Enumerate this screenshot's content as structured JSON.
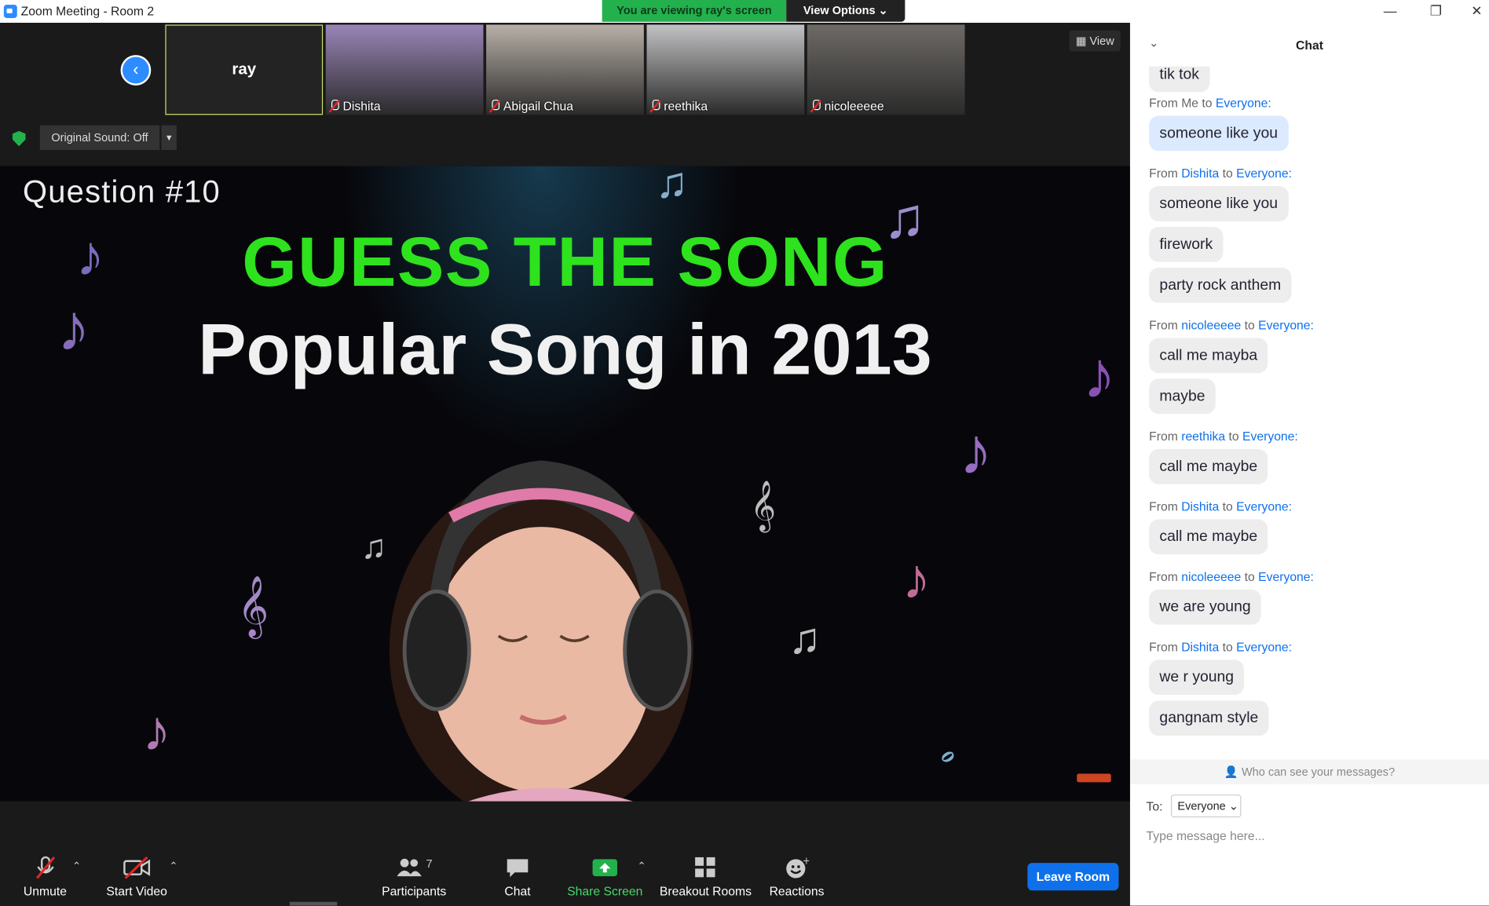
{
  "window": {
    "title": "Zoom Meeting - Room 2",
    "minimize": "—",
    "restore": "❐",
    "close": "✕"
  },
  "banner": {
    "viewing": "You are viewing ray's screen",
    "view_options": "View Options ⌄"
  },
  "gallery": {
    "self_name": "ray",
    "participants": [
      {
        "name": "Dishita",
        "bg": "#9a85b7"
      },
      {
        "name": "Abigail Chua",
        "bg": "#b9b0a8"
      },
      {
        "name": "reethika",
        "bg": "#c2c2c4"
      },
      {
        "name": "nicoleeeee",
        "bg": "#6e6a66"
      }
    ]
  },
  "controls": {
    "original_sound": "Original Sound: Off",
    "view": "View"
  },
  "shared_screen": {
    "question": "Question #10",
    "headline": "GUESS THE SONG",
    "subheadline": "Popular Song in 2013"
  },
  "toolbar": {
    "unmute": "Unmute",
    "start_video": "Start Video",
    "participants": "Participants",
    "participants_count": "7",
    "chat": "Chat",
    "share_screen": "Share Screen",
    "breakout_rooms": "Breakout Rooms",
    "reactions": "Reactions",
    "leave_room": "Leave Room"
  },
  "chat": {
    "title": "Chat",
    "partial_top": "tik tok",
    "messages": [
      {
        "from": "Me",
        "to": "Everyone",
        "texts": [
          "someone like you"
        ]
      },
      {
        "from": "Dishita",
        "to": "Everyone",
        "texts": [
          "someone like you",
          "firework",
          "party rock anthem"
        ]
      },
      {
        "from": "nicoleeeee",
        "to": "Everyone",
        "texts": [
          "call me mayba",
          "maybe"
        ]
      },
      {
        "from": "reethika",
        "to": "Everyone",
        "texts": [
          "call me maybe"
        ]
      },
      {
        "from": "Dishita",
        "to": "Everyone",
        "texts": [
          "call me maybe"
        ]
      },
      {
        "from": "nicoleeeee",
        "to": "Everyone",
        "texts": [
          "we are young"
        ]
      },
      {
        "from": "Dishita",
        "to": "Everyone",
        "texts": [
          "we r young",
          "gangnam style"
        ]
      }
    ],
    "from_word": "From",
    "to_word": "to",
    "who_can_see": "Who can see your messages?",
    "to_label": "To:",
    "to_value": "Everyone",
    "placeholder": "Type message here..."
  },
  "colors": {
    "accent": "#0e71eb",
    "green": "#23b14d",
    "headline": "#2ee21e"
  }
}
